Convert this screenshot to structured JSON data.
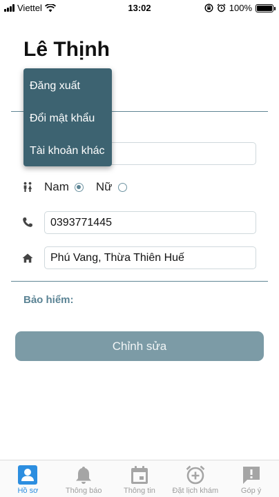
{
  "status_bar": {
    "carrier": "Viettel",
    "time": "13:02",
    "battery_percent": "100%",
    "battery_level": 1.0
  },
  "profile": {
    "name": "Lê Thịnh",
    "gender_options": [
      {
        "label": "Nam",
        "selected": true
      },
      {
        "label": "Nữ",
        "selected": false
      }
    ],
    "phone": "0393771445",
    "address": "Phú Vang, Thừa Thiên Huế",
    "insurance_label": "Bảo hiểm:",
    "edit_label": "Chỉnh sửa"
  },
  "menu": {
    "items": [
      {
        "label": "Đăng xuất"
      },
      {
        "label": "Đổi mật khẩu"
      },
      {
        "label": "Tài khoản khác"
      }
    ]
  },
  "tabbar": {
    "tabs": [
      {
        "label": "Hồ sơ",
        "icon": "profile-icon",
        "active": true
      },
      {
        "label": "Thông báo",
        "icon": "bell-icon",
        "active": false
      },
      {
        "label": "Thông tin",
        "icon": "calendar-icon",
        "active": false
      },
      {
        "label": "Đặt lịch khám",
        "icon": "alarm-add-icon",
        "active": false
      },
      {
        "label": "Góp ý",
        "icon": "feedback-icon",
        "active": false
      }
    ]
  },
  "colors": {
    "accent": "#5a8394",
    "menu_bg": "#3d6371",
    "button_bg": "#7c9ba6",
    "tab_active": "#2c8ee0",
    "tab_inactive": "#9e9e9e"
  }
}
